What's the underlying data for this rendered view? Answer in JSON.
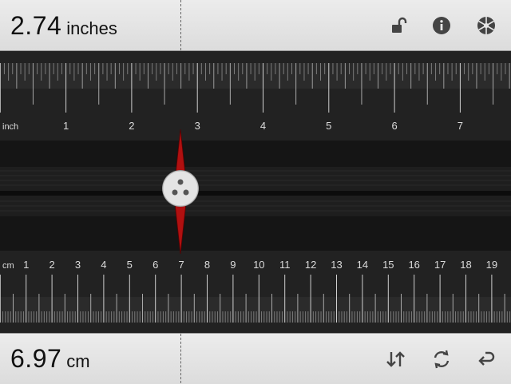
{
  "top_bar": {
    "value": "2.74",
    "unit": "inches",
    "icons": [
      "unlock-icon",
      "info-icon",
      "aperture-icon"
    ]
  },
  "bottom_bar": {
    "value": "6.97",
    "unit": "cm",
    "icons": [
      "swap-vertical-icon",
      "rotate-icon",
      "return-icon"
    ]
  },
  "inch_scale": {
    "unit_label": "inch",
    "labels": [
      "1",
      "2",
      "3",
      "4",
      "5",
      "6",
      "7"
    ]
  },
  "cm_scale": {
    "unit_label": "cm",
    "labels": [
      "1",
      "2",
      "3",
      "4",
      "5",
      "6",
      "7",
      "8",
      "9",
      "10",
      "11",
      "12",
      "13",
      "14",
      "15",
      "16",
      "17",
      "18",
      "19"
    ]
  },
  "marker": {
    "inch_value": 2.74,
    "cm_value": 6.97,
    "color": "#b01010"
  }
}
